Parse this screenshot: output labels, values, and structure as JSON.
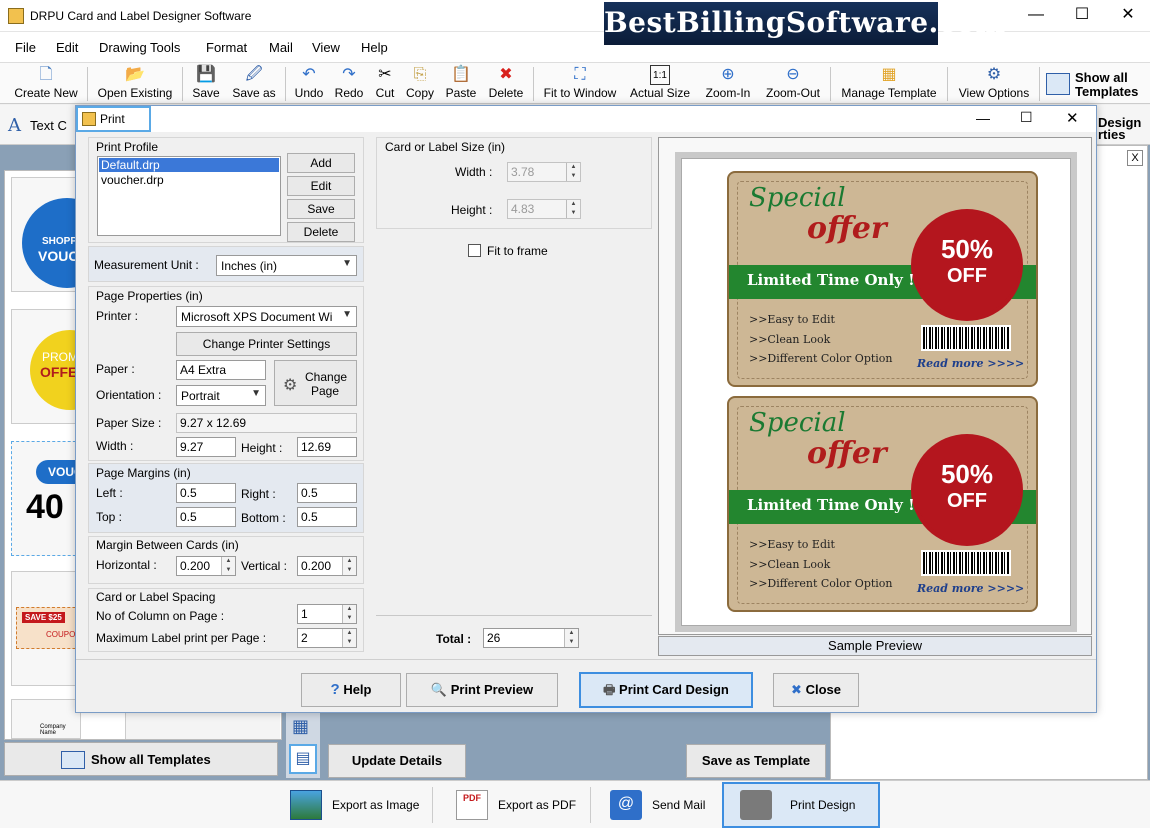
{
  "app": {
    "title": "DRPU Card and Label Designer Software",
    "banner": "BestBillingSoftware.com",
    "minimize": "—",
    "maximize": "☐",
    "close": "✕"
  },
  "menu": [
    "File",
    "Edit",
    "Drawing Tools",
    "Format",
    "Mail",
    "View",
    "Help"
  ],
  "toolbar": {
    "create_new": "Create New",
    "open_existing": "Open Existing",
    "save": "Save",
    "save_as": "Save as",
    "undo": "Undo",
    "redo": "Redo",
    "cut": "Cut",
    "copy": "Copy",
    "paste": "Paste",
    "delete": "Delete",
    "fit_to_window": "Fit to Window",
    "actual_size": "Actual Size",
    "zoom_in": "Zoom-In",
    "zoom_out": "Zoom-Out",
    "manage_template": "Manage Template",
    "view_options": "View Options",
    "show_all_templates_1": "Show all",
    "show_all_templates_2": "Templates"
  },
  "background": {
    "text_tab": "Text C",
    "design_properties_1": "Design",
    "design_properties_2": "rties",
    "close_x": "X",
    "show_all_templates": "Show all Templates",
    "update_details": "Update Details",
    "save_as_template": "Save as Template",
    "thumb_texts": [
      "SHOPP",
      "VOUC",
      "PROM",
      "OFFE",
      "VOUC",
      "40",
      "SAVE $25",
      "COUPON",
      "Company Name"
    ]
  },
  "bottom_bar": {
    "export_image": "Export as Image",
    "export_pdf": "Export as PDF",
    "send_mail": "Send Mail",
    "print_design": "Print Design"
  },
  "dialog": {
    "title": "Print",
    "print_profile": {
      "heading": "Print Profile",
      "items": [
        "Default.drp",
        "voucher.drp"
      ],
      "selected_index": 0,
      "add": "Add",
      "edit": "Edit",
      "save": "Save",
      "delete": "Delete"
    },
    "measurement_unit": {
      "label": "Measurement Unit :",
      "value": "Inches (in)"
    },
    "page_properties": {
      "heading": "Page Properties (in)",
      "printer_label": "Printer :",
      "printer_value": "Microsoft XPS Document Wi",
      "change_printer": "Change Printer Settings",
      "paper_label": "Paper :",
      "paper_value": "A4 Extra",
      "orientation_label": "Orientation :",
      "orientation_value": "Portrait",
      "change_page_1": "Change",
      "change_page_2": "Page",
      "paper_size_label": "Paper Size :",
      "paper_size_value": "9.27 x 12.69",
      "width_label": "Width :",
      "width_value": "9.27",
      "height_label": "Height :",
      "height_value": "12.69"
    },
    "page_margins": {
      "heading": "Page Margins (in)",
      "left_label": "Left :",
      "left_value": "0.5",
      "right_label": "Right :",
      "right_value": "0.5",
      "top_label": "Top :",
      "top_value": "0.5",
      "bottom_label": "Bottom :",
      "bottom_value": "0.5"
    },
    "margin_between_cards": {
      "heading": "Margin Between Cards (in)",
      "horizontal_label": "Horizontal :",
      "horizontal_value": "0.200",
      "vertical_label": "Vertical :",
      "vertical_value": "0.200"
    },
    "card_spacing": {
      "heading": "Card or Label Spacing",
      "columns_label": "No of Column on Page :",
      "columns_value": "1",
      "max_label": "Maximum Label print per Page :",
      "max_value": "2"
    },
    "card_size": {
      "heading": "Card or Label Size (in)",
      "width_label": "Width :",
      "width_value": "3.78",
      "height_label": "Height :",
      "height_value": "4.83",
      "fit_to_frame": "Fit to frame"
    },
    "total_label": "Total :",
    "total_value": "26",
    "sample_preview": "Sample Preview",
    "buttons": {
      "help": "Help",
      "print_preview": "Print Preview",
      "print_card_design": "Print Card Design",
      "close": "Close"
    }
  },
  "card": {
    "special": "Special",
    "offer": "offer",
    "percent": "50%",
    "off": "OFF",
    "limited": "Limited Time Only !",
    "features": [
      ">>Easy to Edit",
      ">>Clean Look",
      ">>Different Color Option"
    ],
    "read_more": "Read more >>>>"
  }
}
